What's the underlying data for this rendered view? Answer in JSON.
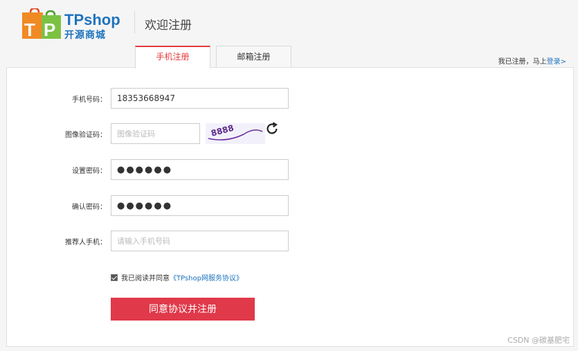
{
  "header": {
    "logo_text": "TPshop",
    "logo_subtext": "开源商城",
    "title": "欢迎注册"
  },
  "tabs": [
    {
      "label": "手机注册",
      "active": true
    },
    {
      "label": "邮箱注册",
      "active": false
    }
  ],
  "login_hint": {
    "text": "我已注册，马上",
    "link": "登录>"
  },
  "form": {
    "phone": {
      "label": "手机号码：",
      "value": "18353668947"
    },
    "captcha": {
      "label": "图像验证码：",
      "placeholder": "图像验证码",
      "image_text": "8888"
    },
    "password": {
      "label": "设置密码：",
      "value": "●●●●●●"
    },
    "confirm": {
      "label": "确认密码：",
      "value": "●●●●●●"
    },
    "referrer": {
      "label": "推荐人手机：",
      "placeholder": "请输入手机号码"
    },
    "agreement": {
      "text": "我已阅读并同意",
      "link": "《TPshop网服务协议》",
      "checked": true
    },
    "submit_label": "同意协议并注册"
  },
  "watermark": "CSDN @碳基肥宅",
  "colors": {
    "brand_blue": "#1e73be",
    "accent_red": "#e4393c",
    "button_red": "#e0394a"
  }
}
